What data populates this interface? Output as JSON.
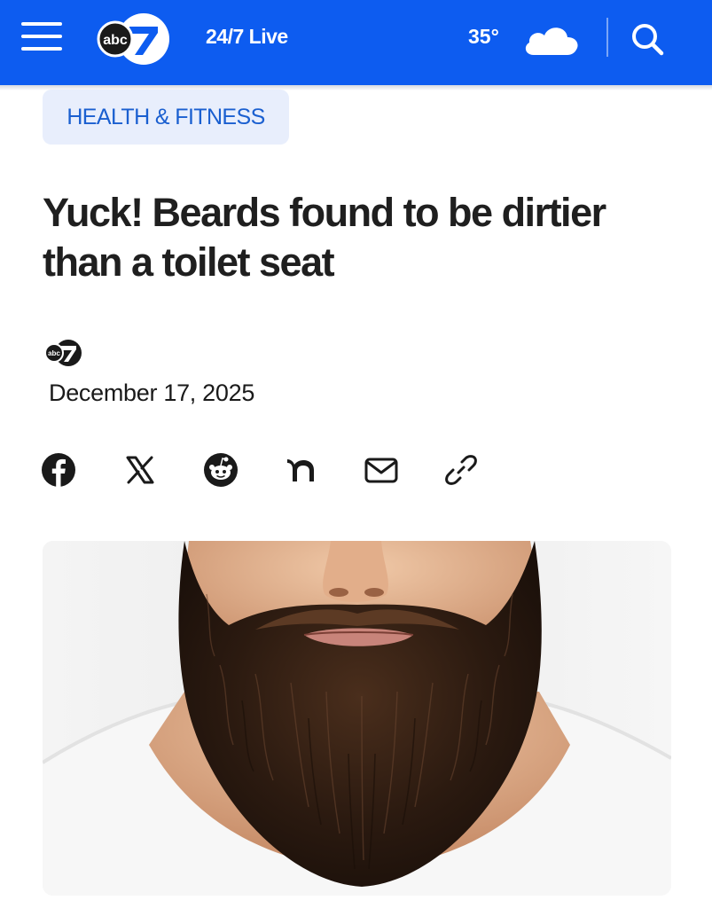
{
  "header": {
    "menu_icon": "hamburger-menu-icon",
    "logo_badge_text": "abc",
    "logo_number": "7",
    "live_label": "24/7 Live",
    "temperature": "35°",
    "weather_icon": "cloud-icon",
    "search_icon": "search-icon",
    "background_color": "#0d5cf0"
  },
  "article": {
    "category": "HEALTH & FITNESS",
    "headline": "Yuck! Beards found to be dirtier than a toilet seat",
    "date": "December 17, 2025",
    "author_logo_badge_text": "abc",
    "author_logo_number": "7"
  },
  "share": {
    "icons": [
      "facebook-icon",
      "x-icon",
      "reddit-icon",
      "nextdoor-icon",
      "email-icon",
      "copy-link-icon"
    ]
  },
  "hero_image": {
    "subject": "bearded-man-photo"
  }
}
